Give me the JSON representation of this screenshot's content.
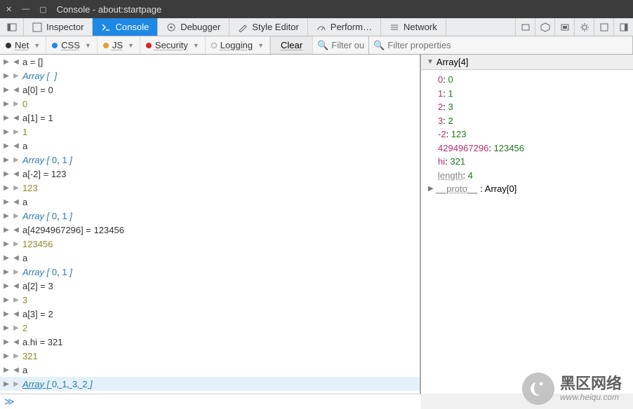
{
  "window": {
    "title": "Console - about:startpage"
  },
  "tabs": {
    "inspector": "Inspector",
    "console": "Console",
    "debugger": "Debugger",
    "style_editor": "Style Editor",
    "performance": "Perform…",
    "network": "Network"
  },
  "filters": {
    "net": "Net",
    "css": "CSS",
    "js": "JS",
    "security": "Security",
    "logging": "Logging",
    "clear": "Clear",
    "filter_out_ph": "Filter out",
    "filter_props_ph": "Filter properties"
  },
  "console_rows": [
    {
      "dir": "in",
      "kind": "input",
      "text": "a = []"
    },
    {
      "dir": "out",
      "kind": "arr",
      "pre": "Array [  ]",
      "nums": []
    },
    {
      "dir": "in",
      "kind": "input",
      "text": "a[0] = 0"
    },
    {
      "dir": "out",
      "kind": "num",
      "text": "0"
    },
    {
      "dir": "in",
      "kind": "input",
      "text": "a[1] = 1"
    },
    {
      "dir": "out",
      "kind": "num",
      "text": "1"
    },
    {
      "dir": "in",
      "kind": "input",
      "text": "a"
    },
    {
      "dir": "out",
      "kind": "arr",
      "nums": [
        0,
        1
      ]
    },
    {
      "dir": "in",
      "kind": "input",
      "text": "a[-2] = 123"
    },
    {
      "dir": "out",
      "kind": "num",
      "text": "123"
    },
    {
      "dir": "in",
      "kind": "input",
      "text": "a"
    },
    {
      "dir": "out",
      "kind": "arr",
      "nums": [
        0,
        1
      ]
    },
    {
      "dir": "in",
      "kind": "input",
      "text": "a[4294967296] = 123456"
    },
    {
      "dir": "out",
      "kind": "num",
      "text": "123456"
    },
    {
      "dir": "in",
      "kind": "input",
      "text": "a"
    },
    {
      "dir": "out",
      "kind": "arr",
      "nums": [
        0,
        1
      ]
    },
    {
      "dir": "in",
      "kind": "input",
      "text": "a[2] = 3"
    },
    {
      "dir": "out",
      "kind": "num",
      "text": "3"
    },
    {
      "dir": "in",
      "kind": "input",
      "text": "a[3] = 2"
    },
    {
      "dir": "out",
      "kind": "num",
      "text": "2"
    },
    {
      "dir": "in",
      "kind": "input",
      "text": "a.hi = 321"
    },
    {
      "dir": "out",
      "kind": "num",
      "text": "321"
    },
    {
      "dir": "in",
      "kind": "input",
      "text": "a"
    },
    {
      "dir": "out",
      "kind": "arr-link",
      "nums": [
        0,
        1,
        3,
        2
      ],
      "selected": true
    }
  ],
  "props": {
    "header": "Array[4]",
    "items": [
      {
        "k": "0",
        "v": "0"
      },
      {
        "k": "1",
        "v": "1"
      },
      {
        "k": "2",
        "v": "3"
      },
      {
        "k": "3",
        "v": "2"
      },
      {
        "k": "-2",
        "v": "123"
      },
      {
        "k": "4294967296",
        "v": "123456"
      },
      {
        "k": "hi",
        "v": "321"
      }
    ],
    "length_k": "length",
    "length_v": "4",
    "proto_k": "__proto__",
    "proto_v": "Array[0]"
  },
  "watermark": {
    "line1": "黑区网络",
    "line2": "www.heiqu.com"
  },
  "colors": {
    "net": "#333",
    "css": "#1e88e5",
    "js": "#e0a030",
    "sec": "#d22",
    "log": "#999"
  }
}
